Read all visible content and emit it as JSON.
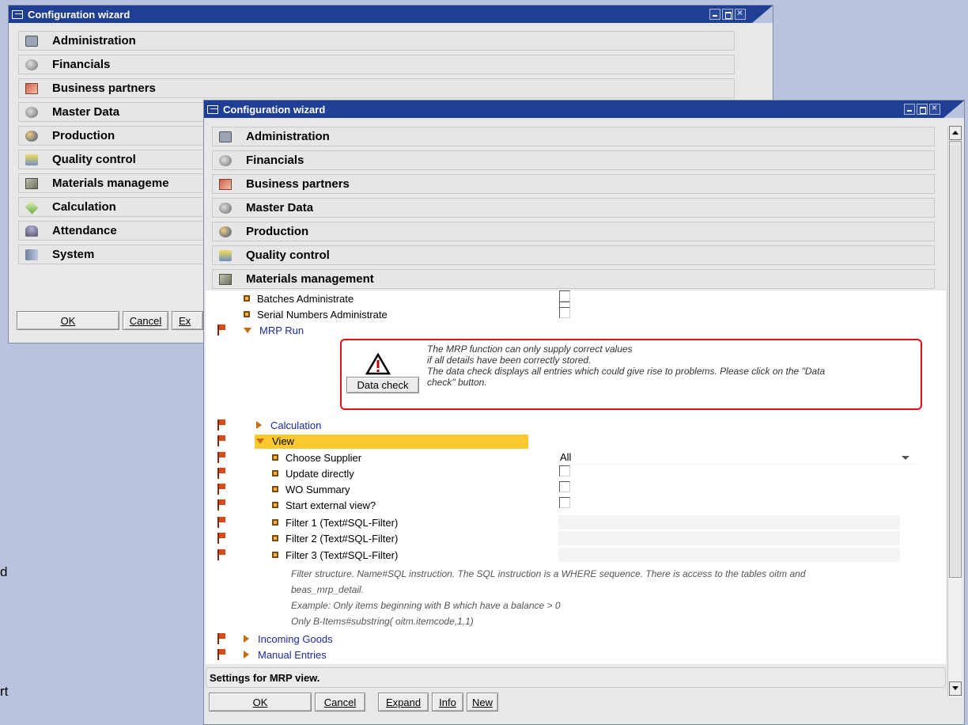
{
  "background": {
    "fragments": [
      "d",
      "rt"
    ]
  },
  "back_window": {
    "title": "Configuration wizard",
    "sections": [
      {
        "icon": "administration-icon",
        "label": "Administration"
      },
      {
        "icon": "financials-icon",
        "label": "Financials"
      },
      {
        "icon": "business-partners-icon",
        "label": "Business partners"
      },
      {
        "icon": "master-data-icon",
        "label": "Master Data"
      },
      {
        "icon": "production-icon",
        "label": "Production"
      },
      {
        "icon": "quality-control-icon",
        "label": "Quality control"
      },
      {
        "icon": "materials-management-icon",
        "label": "Materials manageme"
      },
      {
        "icon": "calculation-icon",
        "label": "Calculation"
      },
      {
        "icon": "attendance-icon",
        "label": "Attendance"
      },
      {
        "icon": "system-icon",
        "label": "System"
      }
    ],
    "buttons": {
      "ok": "OK",
      "cancel": "Cancel",
      "expand": "Ex"
    }
  },
  "front_window": {
    "title": "Configuration wizard",
    "sections": [
      {
        "icon": "administration-icon",
        "label": "Administration"
      },
      {
        "icon": "financials-icon",
        "label": "Financials"
      },
      {
        "icon": "business-partners-icon",
        "label": "Business partners"
      },
      {
        "icon": "master-data-icon",
        "label": "Master Data"
      },
      {
        "icon": "production-icon",
        "label": "Production"
      },
      {
        "icon": "quality-control-icon",
        "label": "Quality control"
      },
      {
        "icon": "materials-management-icon",
        "label": "Materials management"
      }
    ],
    "mm_items": {
      "batches": "Batches Administrate",
      "serials": "Serial Numbers Administrate",
      "mrp_run": "MRP Run"
    },
    "warning": {
      "line1": "The MRP function can only supply correct values",
      "line2": "if all details have been correctly stored.",
      "line3": "The data check displays all entries which could give rise to problems. Please click on the \"Data",
      "line4": "check\" button.",
      "button": "Data check"
    },
    "mrp_children": {
      "calculation": "Calculation",
      "view": "View",
      "choose_supplier": "Choose Supplier",
      "choose_supplier_value": "All",
      "update_directly": "Update directly",
      "wo_summary": "WO Summary",
      "start_external": "Start external view?",
      "filter1": "Filter 1 (Text#SQL-Filter)",
      "filter2": "Filter 2 (Text#SQL-Filter)",
      "filter3": "Filter 3 (Text#SQL-Filter)",
      "help1": "Filter structure. Name#SQL instruction. The SQL instruction is a WHERE sequence. There is access to the tables oitm and",
      "help2": "beas_mrp_detail.",
      "help3": "Example: Only items beginning with B which have a balance > 0",
      "help4": "Only B-Items#substring( oitm.itemcode,1,1)",
      "incoming": "Incoming Goods",
      "manual": "Manual Entries"
    },
    "status": "Settings for MRP view.",
    "buttons": {
      "ok": "OK",
      "cancel": "Cancel",
      "expand": "Expand",
      "info": "Info",
      "new": "New"
    }
  }
}
